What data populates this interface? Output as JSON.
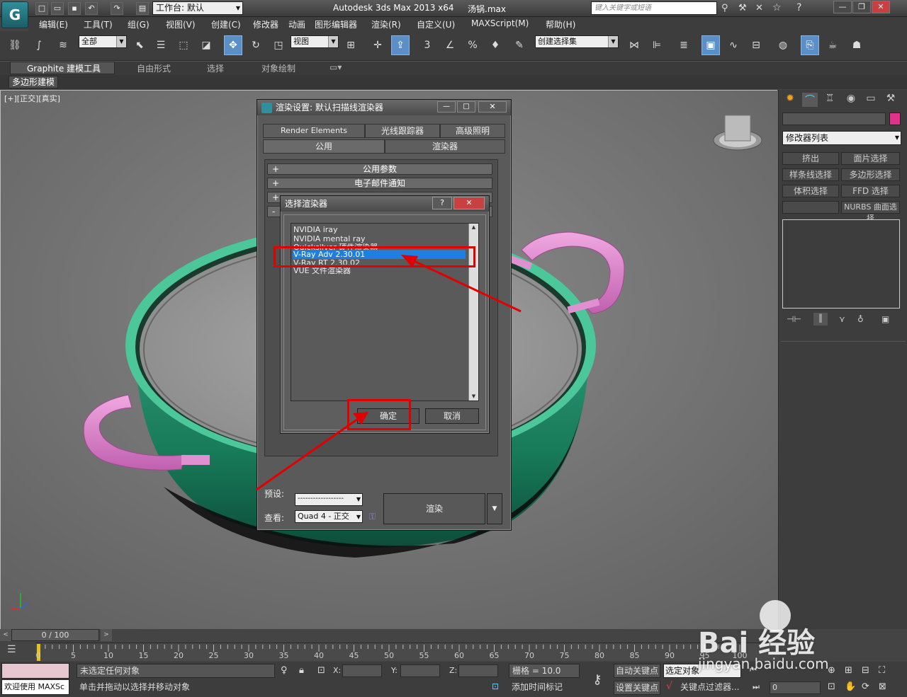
{
  "app": {
    "workspace_label": "工作台: 默认",
    "title": "Autodesk 3ds Max  2013 x64",
    "file": "汤锅.max",
    "search_placeholder": "键入关键字或短语"
  },
  "menu": [
    "编辑(E)",
    "工具(T)",
    "组(G)",
    "视图(V)",
    "创建(C)",
    "修改器",
    "动画",
    "图形编辑器",
    "渲染(R)",
    "自定义(U)",
    "MAXScript(M)",
    "帮助(H)"
  ],
  "toolbar": {
    "selection_filter": "全部",
    "coord_system": "视图",
    "named_selection": "创建选择集"
  },
  "ribbon": {
    "tabs": [
      "Graphite 建模工具",
      "自由形式",
      "选择",
      "对象绘制"
    ],
    "sub": "多边形建模"
  },
  "viewport": {
    "label": "[+][正交][真实]"
  },
  "command_panel": {
    "modifier_list": "修改器列表",
    "buttons": [
      "挤出",
      "面片选择",
      "样条线选择",
      "多边形选择",
      "体积选择",
      "FFD 选择",
      "",
      "NURBS 曲面选择"
    ],
    "accent": "#e0328a"
  },
  "render_dialog": {
    "title": "渲染设置: 默认扫描线渲染器",
    "tabs_row1": [
      "Render Elements",
      "光线跟踪器",
      "高级照明"
    ],
    "tabs_row2": [
      "公用",
      "渲染器"
    ],
    "rollouts": [
      "公用参数",
      "电子邮件通知"
    ],
    "preset_label": "预设:",
    "preset_value": "------------------",
    "view_label": "查看:",
    "view_value": "Quad 4 - 正交",
    "render_button": "渲染"
  },
  "choose_dialog": {
    "title": "选择渲染器",
    "items": [
      "NVIDIA iray",
      "NVIDIA mental ray",
      "Quicksilver 硬件渲染器",
      "V-Ray Adv 2.30.01",
      "V-Ray RT 2.30.02",
      "VUE 文件渲染器"
    ],
    "selected_index": 3,
    "ok": "确定",
    "cancel": "取消",
    "highlight_color": "#1e7ee2"
  },
  "timeline": {
    "frame_counter": "0 / 100",
    "ticks": [
      "0",
      "5",
      "10",
      "15",
      "20",
      "25",
      "30",
      "35",
      "40",
      "45",
      "50",
      "55",
      "60",
      "65",
      "70",
      "75",
      "80",
      "85",
      "90",
      "95",
      "100"
    ]
  },
  "status": {
    "welcome": "欢迎使用  MAXSc",
    "line1": "未选定任何对象",
    "line2": "单击并拖动以选择并移动对象",
    "x_label": "X:",
    "y_label": "Y:",
    "z_label": "Z:",
    "grid": "栅格 = 10.0",
    "add_time_tag": "添加时间标记",
    "auto_key": "自动关键点",
    "set_key": "设置关键点",
    "selected_object": "选定对象",
    "key_filter": "关键点过滤器...",
    "frame_value": "0"
  },
  "watermark": {
    "brand": "Bai  经验",
    "url": "jingyan.baidu.com"
  },
  "annotation_color": "#e00000"
}
